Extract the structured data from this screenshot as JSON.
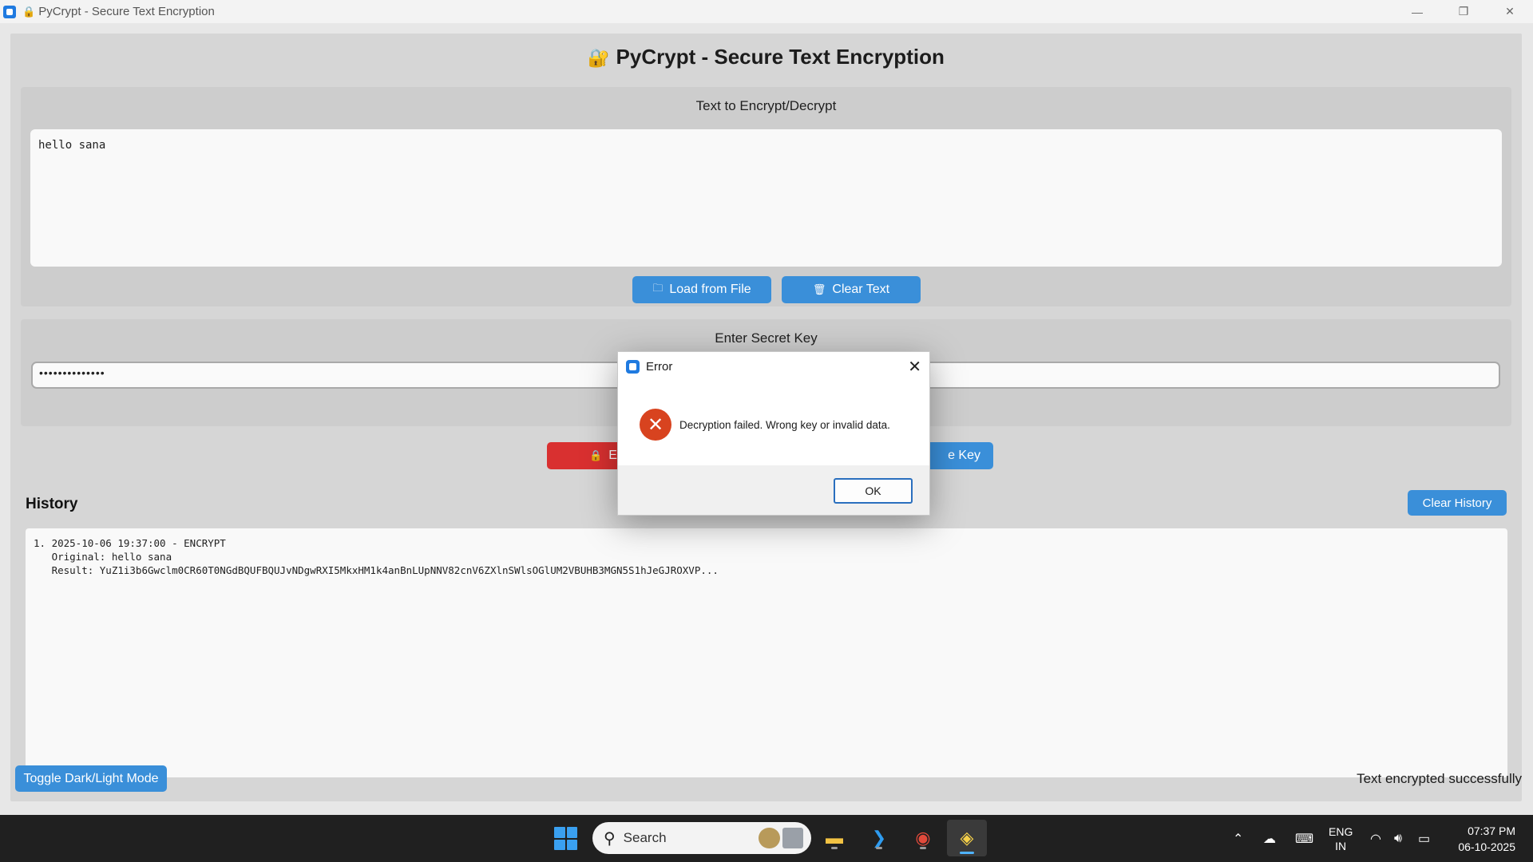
{
  "window": {
    "title": "PyCrypt - Secure Text Encryption",
    "controls": {
      "minimize": "—",
      "restore": "❐",
      "close": "✕"
    }
  },
  "app": {
    "heading": "PyCrypt - Secure Text Encryption",
    "heading_icon": "lock-icon",
    "text_section": {
      "label": "Text to Encrypt/Decrypt",
      "value": "hello sana",
      "load_button": "Load from File",
      "clear_button": "Clear Text"
    },
    "key_section": {
      "label": "Enter Secret Key",
      "value": "••••••••••••••"
    },
    "actions": {
      "encrypt_button": "En",
      "key_button": "e Key"
    },
    "history": {
      "title": "History",
      "clear_button": "Clear History",
      "content": "1. 2025-10-06 19:37:00 - ENCRYPT\n   Original: hello sana\n   Result: YuZ1i3b6Gwclm0CR60T0NGdBQUFBQUJvNDgwRXI5MkxHM1k4anBnLUpNNV82cnV6ZXlnSWlsOGlUM2VBUHB3MGN5S1hJeGJROXVP..."
    },
    "footer": {
      "toggle_button": "Toggle Dark/Light Mode",
      "status": "Text encrypted successfully"
    }
  },
  "dialog": {
    "title": "Error",
    "message": "Decryption failed. Wrong key or invalid data.",
    "ok_button": "OK",
    "close": "✕",
    "error_color": "#d8431f"
  },
  "taskbar": {
    "search_placeholder": "Search",
    "language": "ENG",
    "region": "IN",
    "time": "07:37 PM",
    "date": "06-10-2025"
  },
  "colors": {
    "accent": "#3a8fd9",
    "danger": "#d93030"
  }
}
